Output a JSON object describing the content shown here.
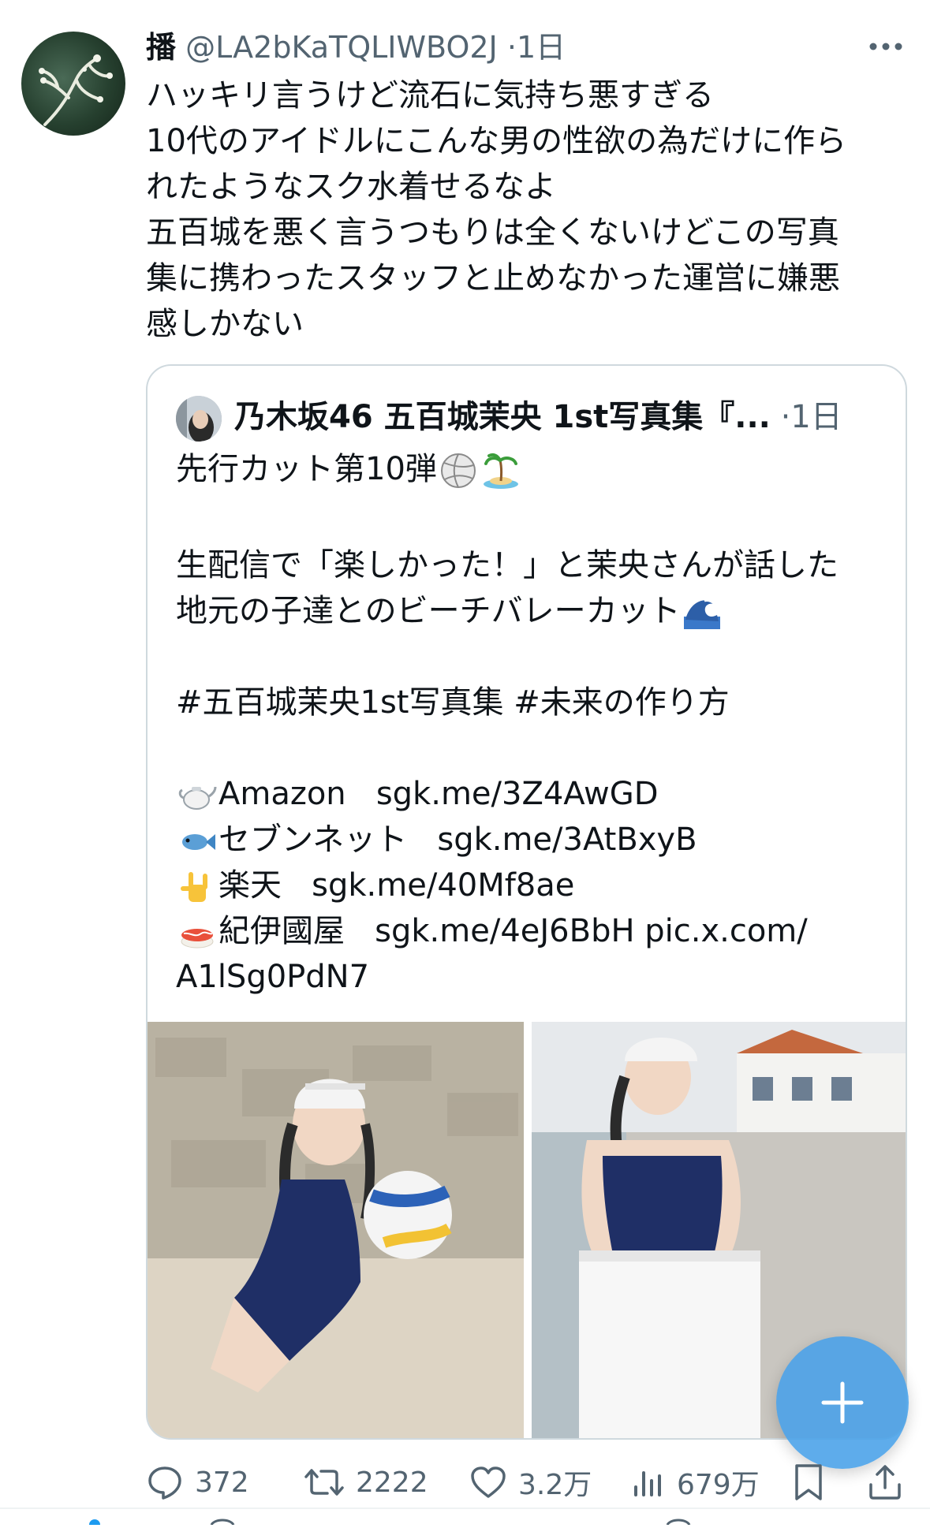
{
  "post": {
    "author_name": "播",
    "handle": "@LA2bKaTQLIWBO2J",
    "separator": "·",
    "time": "1日",
    "avatar_icon": "coral-branch-avatar",
    "more_icon": "more-horizontal-icon",
    "text_lines": [
      "ハッキリ言うけど流石に気持ち悪すぎる",
      "10代のアイドルにこんな男の性欲の為だけに作ら",
      "れたようなスク水着せるなよ",
      "五百城を悪く言うつもりは全くないけどこの写真",
      "集に携わったスタッフと止めなかった運営に嫌悪",
      "感しかない"
    ]
  },
  "quote": {
    "author_name": "乃木坂46 五百城茉央 1st写真集『...",
    "separator": "·",
    "time": "1日",
    "line1": "先行カット第10弾",
    "line2": "生配信で「楽しかった！」と茉央さんが話した",
    "line3": "地元の子達とのビーチバレーカット",
    "hashtags": "#五百城茉央1st写真集 #未来の作り方",
    "links": [
      {
        "emoji": "teapot-emoji",
        "label": "Amazon",
        "url": "sgk.me/3Z4AwGD"
      },
      {
        "emoji": "fish-emoji",
        "label": "セブンネット",
        "url": "sgk.me/3AtBxyB"
      },
      {
        "emoji": "love-you-gesture-emoji",
        "label": "楽天",
        "url": "sgk.me/40Mf8ae"
      },
      {
        "emoji": "sushi-emoji",
        "label": "紀伊國屋",
        "url": "sgk.me/4eJ6BbH pic.x.com/"
      }
    ],
    "trailing_link": "A1lSg0PdN7",
    "emojis": [
      "volleyball-emoji",
      "desert-island-emoji",
      "wave-emoji"
    ]
  },
  "actions": {
    "replies": "372",
    "reposts": "2222",
    "likes": "3.2万",
    "views": "679万"
  },
  "colors": {
    "text": "#0f1419",
    "secondary": "#536471",
    "border": "#cfd9de",
    "fab": "#48a0e8"
  }
}
